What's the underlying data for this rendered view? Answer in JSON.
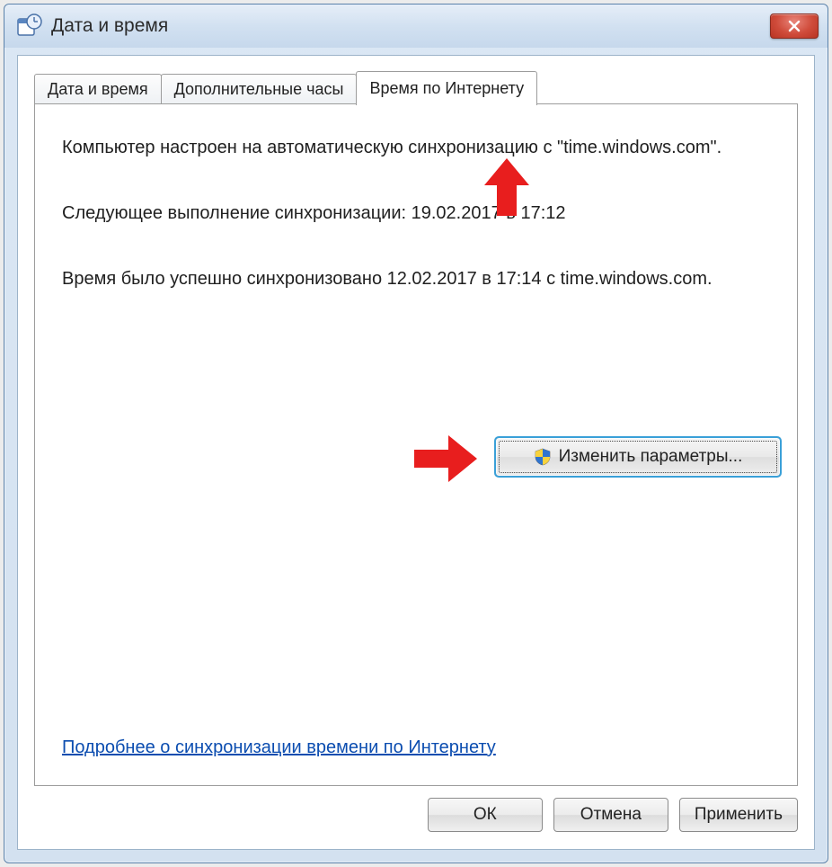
{
  "window": {
    "title": "Дата и время"
  },
  "tabs": [
    {
      "label": "Дата и время",
      "active": false
    },
    {
      "label": "Дополнительные часы",
      "active": false
    },
    {
      "label": "Время по Интернету",
      "active": true
    }
  ],
  "content": {
    "sync_configured": "Компьютер настроен на автоматическую синхронизацию с \"time.windows.com\".",
    "next_sync": "Следующее выполнение синхронизации: 19.02.2017 в 17:12",
    "last_sync": "Время было успешно синхронизовано 12.02.2017 в 17:14 с time.windows.com.",
    "change_settings": "Изменить параметры...",
    "help_link": "Подробнее о синхронизации времени по Интернету"
  },
  "buttons": {
    "ok": "ОК",
    "cancel": "Отмена",
    "apply": "Применить"
  },
  "annotations": {
    "arrow_up": "arrow-up-red-indicator",
    "arrow_right": "arrow-right-red-indicator"
  }
}
